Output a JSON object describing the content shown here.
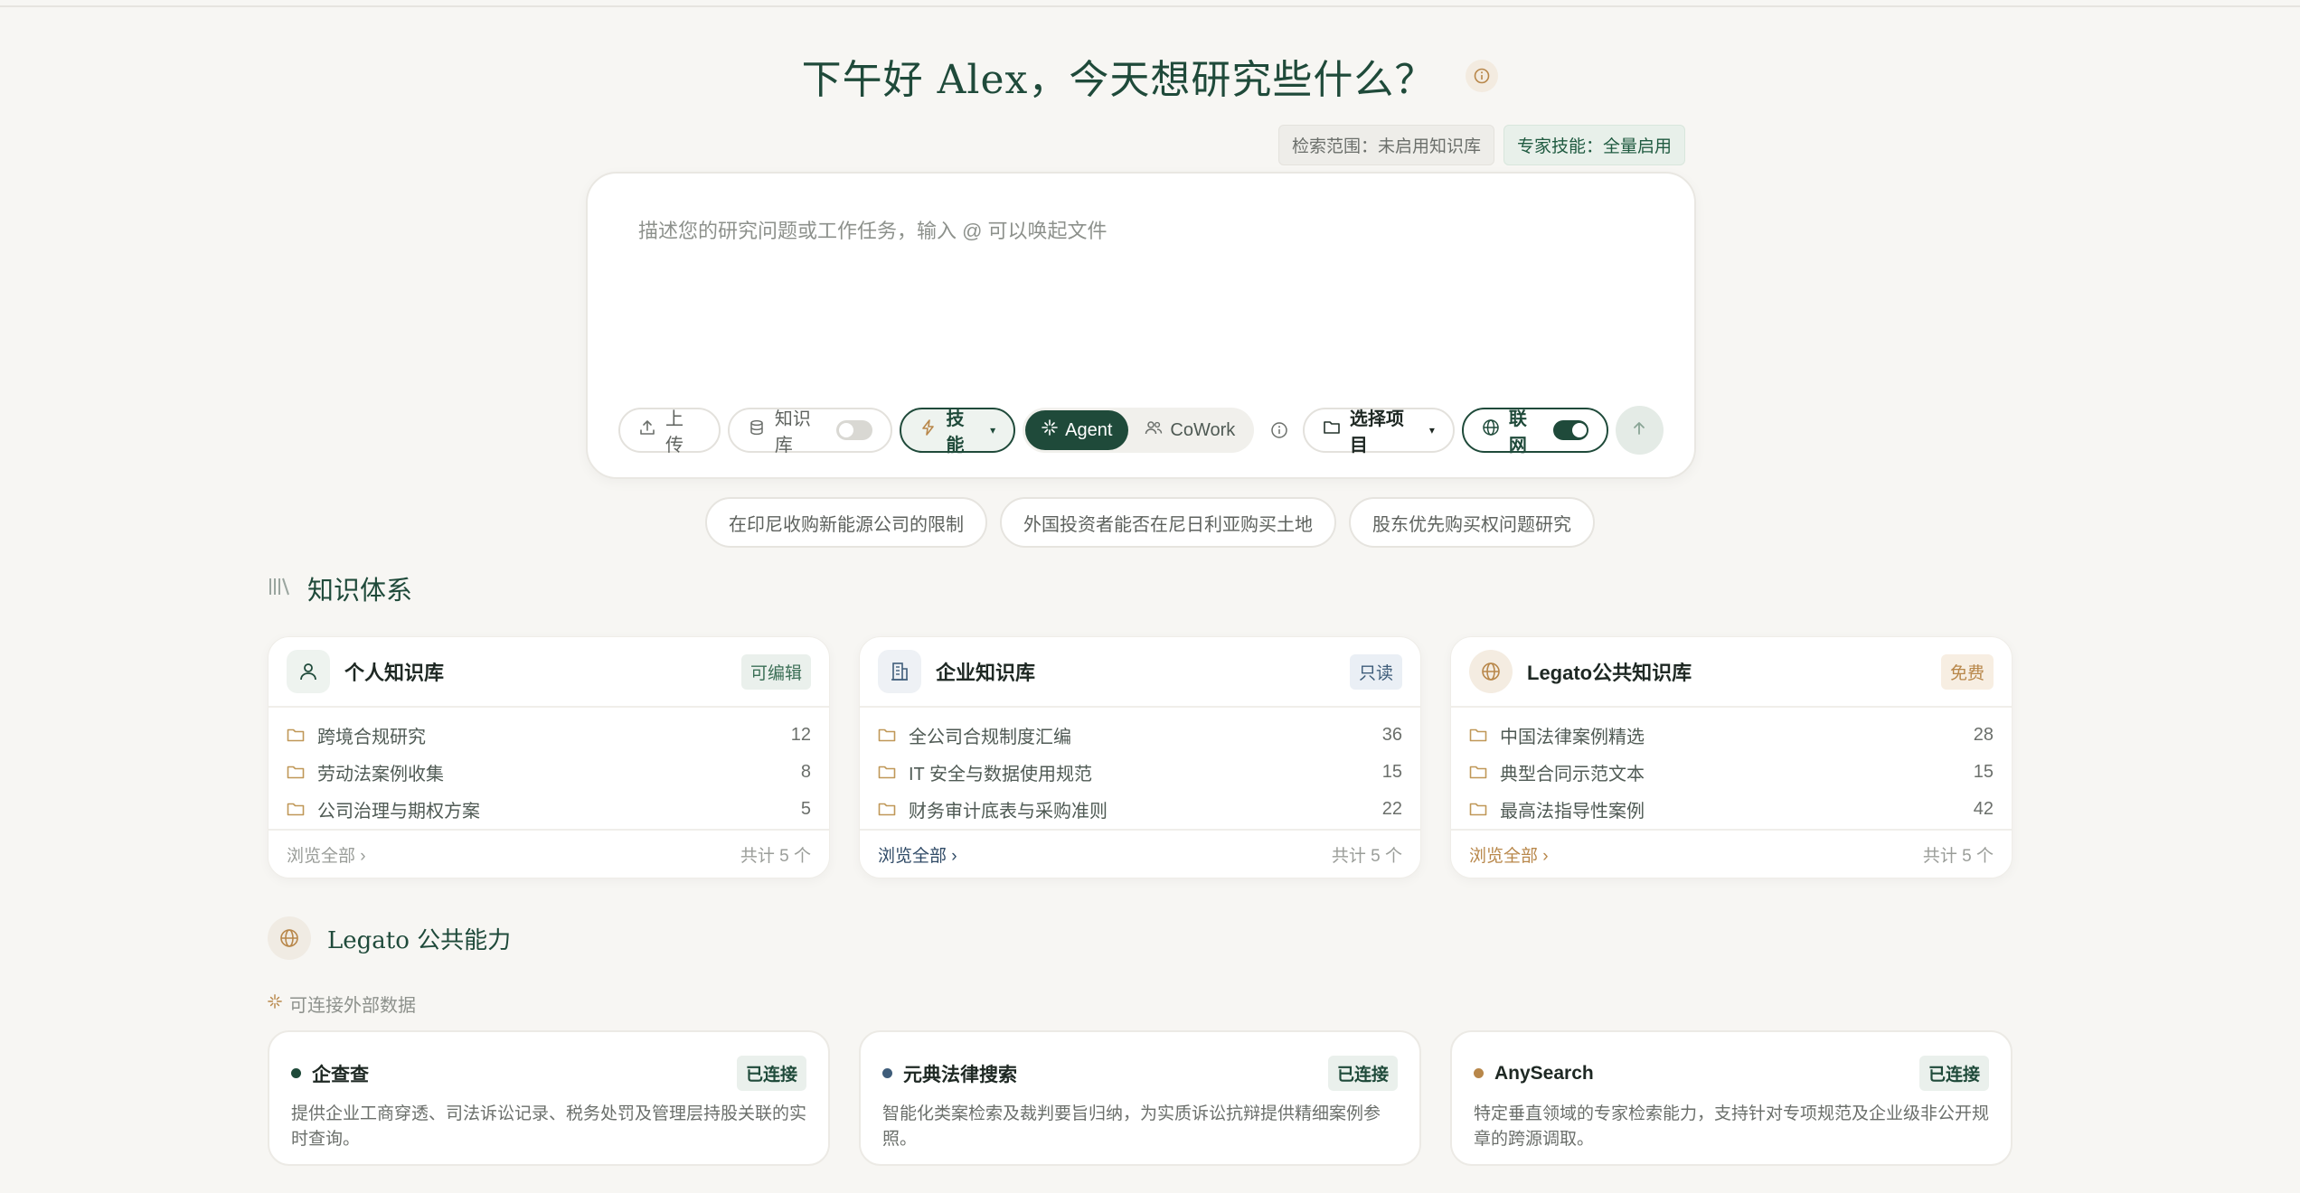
{
  "header": {
    "greeting": "下午好 Alex，今天想研究些什么？",
    "scope_tag": "检索范围：未启用知识库",
    "skills_tag": "专家技能：全量启用"
  },
  "composer": {
    "placeholder": "描述您的研究问题或工作任务，输入 @ 可以唤起文件",
    "upload_label": "上传",
    "kb_label": "知识库",
    "kb_enabled": false,
    "skills_label": "技能",
    "mode_agent": "Agent",
    "mode_cowork": "CoWork",
    "mode_selected": "Agent",
    "project_label": "选择项目",
    "net_label": "联网",
    "net_enabled": true
  },
  "suggestions": [
    "在印尼收购新能源公司的限制",
    "外国投资者能否在尼日利亚购买土地",
    "股东优先购买权问题研究"
  ],
  "knowledge": {
    "section_title": "知识体系",
    "cards": [
      {
        "title": "个人知识库",
        "badge": "可编辑",
        "items": [
          {
            "name": "跨境合规研究",
            "count": "12"
          },
          {
            "name": "劳动法案例收集",
            "count": "8"
          },
          {
            "name": "公司治理与期权方案",
            "count": "5"
          }
        ],
        "browse": "浏览全部 ›",
        "total": "共计 5 个"
      },
      {
        "title": "企业知识库",
        "badge": "只读",
        "items": [
          {
            "name": "全公司合规制度汇编",
            "count": "36"
          },
          {
            "name": "IT 安全与数据使用规范",
            "count": "15"
          },
          {
            "name": "财务审计底表与采购准则",
            "count": "22"
          }
        ],
        "browse": "浏览全部 ›",
        "total": "共计 5 个"
      },
      {
        "title": "Legato公共知识库",
        "badge": "免费",
        "items": [
          {
            "name": "中国法律案例精选",
            "count": "28"
          },
          {
            "name": "典型合同示范文本",
            "count": "15"
          },
          {
            "name": "最高法指导性案例",
            "count": "42"
          }
        ],
        "browse": "浏览全部 ›",
        "total": "共计 5 个"
      }
    ]
  },
  "capabilities": {
    "section_title": "Legato 公共能力",
    "connect_label": "可连接外部数据",
    "cards": [
      {
        "title": "企查查",
        "status": "已连接",
        "dot_color": "#1f4a3a",
        "desc": "提供企业工商穿透、司法诉讼记录、税务处罚及管理层持股关联的实时查询。"
      },
      {
        "title": "元典法律搜索",
        "status": "已连接",
        "dot_color": "#3f5d7a",
        "desc": "智能化类案检索及裁判要旨归纳，为实质诉讼抗辩提供精细案例参照。"
      },
      {
        "title": "AnySearch",
        "status": "已连接",
        "dot_color": "#b8874a",
        "desc": "特定垂直领域的专家检索能力，支持针对专项规范及企业级非公开规章的跨源调取。"
      }
    ]
  },
  "colors": {
    "primary": "#1f4a3a",
    "personal_accent": "#1f4a3a",
    "enterprise_accent": "#3f5d7a",
    "public_accent": "#b8874a",
    "folder": "#c09858"
  },
  "icons": {
    "greeting_info": "info-icon",
    "upload": "upload-icon",
    "kb": "database-icon",
    "skills": "lightning-icon",
    "agent": "sparkle-icon",
    "cowork": "users-icon",
    "project": "folder-icon",
    "net": "globe-icon",
    "send": "arrow-up-icon",
    "knowledge_section": "library-icon",
    "personal": "user-icon",
    "enterprise": "building-icon",
    "public": "globe-icon",
    "item": "folder-icon"
  }
}
